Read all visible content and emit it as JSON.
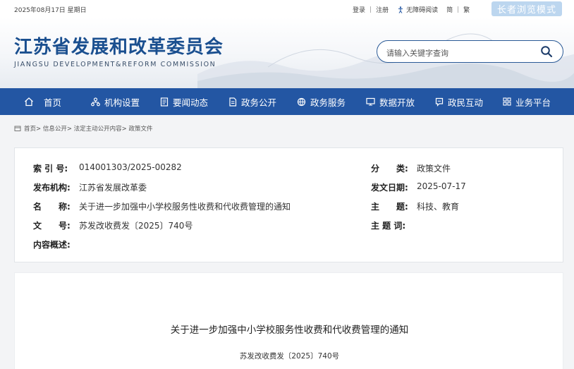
{
  "topbar": {
    "date": "2025年08月17日 星期日",
    "login": "登录",
    "register": "注册",
    "accessible": "无障碍阅读",
    "simplified": "简",
    "traditional": "繁",
    "elder_mode": "长者浏览模式"
  },
  "header": {
    "title": "江苏省发展和改革委员会",
    "subtitle": "JIANGSU DEVELOPMENT&REFORM COMMISSION",
    "search_placeholder": "请输入关键字查询"
  },
  "nav": {
    "items": [
      {
        "label": "首页",
        "icon": "home-icon"
      },
      {
        "label": "机构设置",
        "icon": "org-icon"
      },
      {
        "label": "要闻动态",
        "icon": "news-icon"
      },
      {
        "label": "政务公开",
        "icon": "doc-icon"
      },
      {
        "label": "政务服务",
        "icon": "service-icon"
      },
      {
        "label": "数据开放",
        "icon": "data-icon"
      },
      {
        "label": "政民互动",
        "icon": "chat-icon"
      },
      {
        "label": "业务平台",
        "icon": "grid-icon"
      }
    ]
  },
  "breadcrumb": "首页> 信息公开> 法定主动公开内容> 政策文件",
  "meta": {
    "index_label": "索 引 号:",
    "index_value": "014001303/2025-00282",
    "category_label": "分　　类:",
    "category_value": "政策文件",
    "publisher_label": "发布机构:",
    "publisher_value": "江苏省发展改革委",
    "date_label": "发文日期:",
    "date_value": "2025-07-17",
    "name_label": "名　　称:",
    "name_value": "关于进一步加强中小学校服务性收费和代收费管理的通知",
    "topic_label": "主　　题:",
    "topic_value": "科技、教育",
    "docno_label": "文　　号:",
    "docno_value": "苏发改收费发〔2025〕740号",
    "keywords_label": "主 题 词:",
    "keywords_value": "",
    "summary_label": "内容概述:",
    "summary_value": ""
  },
  "document": {
    "title": "关于进一步加强中小学校服务性收费和代收费管理的通知",
    "number": "苏发改收费发〔2025〕740号"
  },
  "colors": {
    "nav_bg": "#2356a3",
    "title_blue": "#1a4f8f",
    "elder_btn": "#bcd6ef"
  }
}
